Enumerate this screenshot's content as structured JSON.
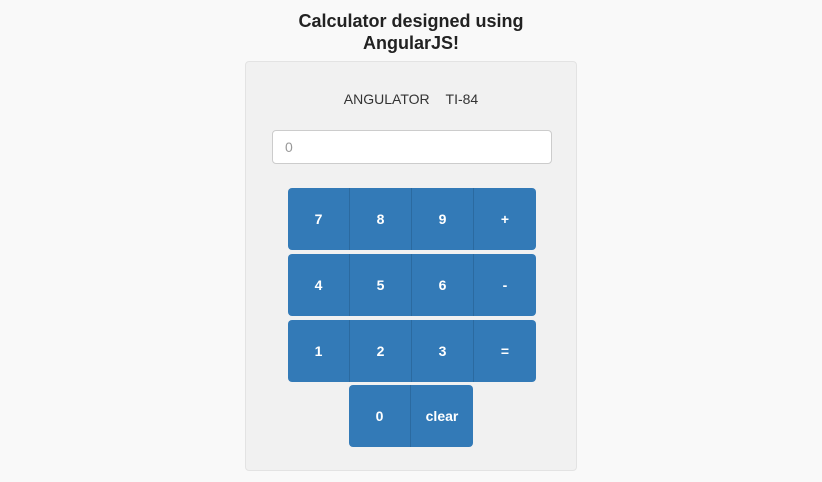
{
  "page": {
    "title_line1": "Calculator designed using",
    "title_line2": "AngularJS!"
  },
  "calculator": {
    "brand_name": "ANGULATOR",
    "model": "TI-84",
    "display_placeholder": "0",
    "display_value": "",
    "keys": {
      "row1": [
        "7",
        "8",
        "9",
        "+"
      ],
      "row2": [
        "4",
        "5",
        "6",
        "-"
      ],
      "row3": [
        "1",
        "2",
        "3",
        "="
      ],
      "row4": [
        "0",
        "clear"
      ]
    }
  },
  "colors": {
    "key_background": "#337ab7",
    "key_text": "#ffffff",
    "panel_background": "#f1f1f1"
  }
}
